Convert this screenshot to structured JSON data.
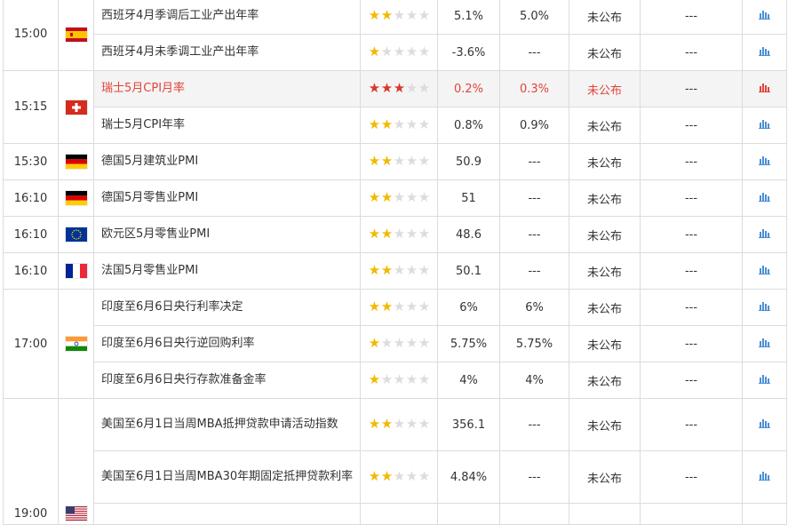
{
  "colors": {
    "star_on": "#f2b900",
    "star_red": "#d9362c",
    "star_off": "#dcdcdc",
    "highlight_text": "#e0453a",
    "chart_icon": "#4a8fd6",
    "chart_icon_red": "#e0453a"
  },
  "groups": [
    {
      "time": "15:00",
      "flag": "spain-flag",
      "rows": [
        {
          "name": "西班牙4月季调后工业产出年率",
          "stars": 2,
          "prev": "5.1%",
          "forecast": "5.0%",
          "actual": "未公布",
          "impact": "---"
        },
        {
          "name": "西班牙4月未季调工业产出年率",
          "stars": 1,
          "prev": "-3.6%",
          "forecast": "---",
          "actual": "未公布",
          "impact": "---"
        }
      ]
    },
    {
      "time": "15:15",
      "flag": "switzerland-flag",
      "rows": [
        {
          "name": "瑞士5月CPI月率",
          "stars": 3,
          "prev": "0.2%",
          "forecast": "0.3%",
          "actual": "未公布",
          "impact": "---",
          "highlight": true
        },
        {
          "name": "瑞士5月CPI年率",
          "stars": 2,
          "prev": "0.8%",
          "forecast": "0.9%",
          "actual": "未公布",
          "impact": "---"
        }
      ]
    },
    {
      "time": "15:30",
      "flag": "germany-flag",
      "rows": [
        {
          "name": "德国5月建筑业PMI",
          "stars": 2,
          "prev": "50.9",
          "forecast": "---",
          "actual": "未公布",
          "impact": "---"
        }
      ]
    },
    {
      "time": "16:10",
      "flag": "germany-flag",
      "rows": [
        {
          "name": "德国5月零售业PMI",
          "stars": 2,
          "prev": "51",
          "forecast": "---",
          "actual": "未公布",
          "impact": "---"
        }
      ]
    },
    {
      "time": "16:10",
      "flag": "eu-flag",
      "rows": [
        {
          "name": "欧元区5月零售业PMI",
          "stars": 2,
          "prev": "48.6",
          "forecast": "---",
          "actual": "未公布",
          "impact": "---"
        }
      ]
    },
    {
      "time": "16:10",
      "flag": "france-flag",
      "rows": [
        {
          "name": "法国5月零售业PMI",
          "stars": 2,
          "prev": "50.1",
          "forecast": "---",
          "actual": "未公布",
          "impact": "---"
        }
      ]
    },
    {
      "time": "17:00",
      "flag": "india-flag",
      "rows": [
        {
          "name": "印度至6月6日央行利率决定",
          "stars": 2,
          "prev": "6%",
          "forecast": "6%",
          "actual": "未公布",
          "impact": "---"
        },
        {
          "name": "印度至6月6日央行逆回购利率",
          "stars": 1,
          "prev": "5.75%",
          "forecast": "5.75%",
          "actual": "未公布",
          "impact": "---"
        },
        {
          "name": "印度至6月6日央行存款准备金率",
          "stars": 1,
          "prev": "4%",
          "forecast": "4%",
          "actual": "未公布",
          "impact": "---"
        }
      ]
    },
    {
      "time": "19:00",
      "flag": "usa-flag",
      "rows": [
        {
          "name": "美国至6月1日当周MBA抵押贷款申请活动指数",
          "stars": 2,
          "prev": "356.1",
          "forecast": "---",
          "actual": "未公布",
          "impact": "---",
          "tall": true
        },
        {
          "name": "美国至6月1日当周MBA30年期固定抵押贷款利率",
          "stars": 2,
          "prev": "4.84%",
          "forecast": "---",
          "actual": "未公布",
          "impact": "---",
          "tall": true
        },
        {
          "name": "",
          "stars": 0,
          "prev": "",
          "forecast": "",
          "actual": "",
          "impact": "",
          "partial": true
        }
      ]
    }
  ]
}
